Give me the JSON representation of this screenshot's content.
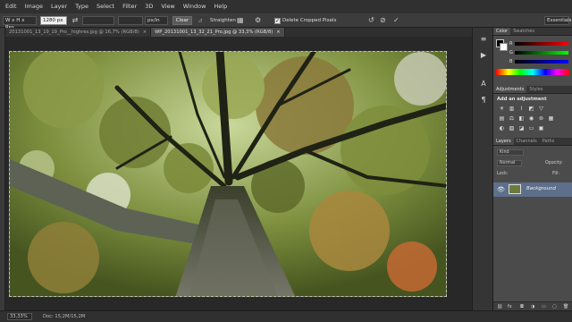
{
  "menubar": {
    "items": [
      "Edit",
      "Image",
      "Layer",
      "Type",
      "Select",
      "Filter",
      "3D",
      "View",
      "Window",
      "Help"
    ]
  },
  "options": {
    "ratio_preset": "W x H x Res.",
    "width_value": "1280 px",
    "height_value": "",
    "resolution_value": "",
    "resolution_unit": "px/in",
    "clear_label": "Clear",
    "straighten_label": "Straighten",
    "delete_cropped_label": "Delete Cropped Pixels",
    "delete_cropped_checked": true,
    "workspace_label": "Essentials"
  },
  "tabs": [
    {
      "label": "20131001_13_19_19_Pro__highres.jpg @ 16,7% (RGB/8)",
      "active": false
    },
    {
      "label": "WP_20131001_13_32_21_Pro.jpg @ 33,3% (RGB/8)",
      "active": true
    }
  ],
  "status": {
    "zoom": "33,33%",
    "doc": "Doc: 15,2M/15,2M"
  },
  "color_panel": {
    "tabs": [
      "Color",
      "Swatches"
    ],
    "channels": [
      "R",
      "G",
      "B"
    ]
  },
  "adjustments_panel": {
    "tabs": [
      "Adjustments",
      "Styles"
    ],
    "heading": "Add an adjustment"
  },
  "layers_panel": {
    "tabs": [
      "Layers",
      "Channels",
      "Paths"
    ],
    "filter_kind": "Kind",
    "blend_mode": "Normal",
    "opacity_label": "Opacity:",
    "lock_label": "Lock:",
    "fill_label": "Fill:",
    "layer_name": "Background"
  },
  "colors": {
    "canvas_bg": "#282828",
    "panel_bg": "#4b4b4b",
    "selected_layer": "#5d6f8a"
  },
  "icons": [
    "move-tool-icon",
    "swap-icon",
    "crop-grid-icon",
    "gear-icon",
    "reset-icon",
    "cancel-icon",
    "commit-icon",
    "play-icon",
    "text-icon",
    "paragraph-icon",
    "eye-icon"
  ]
}
